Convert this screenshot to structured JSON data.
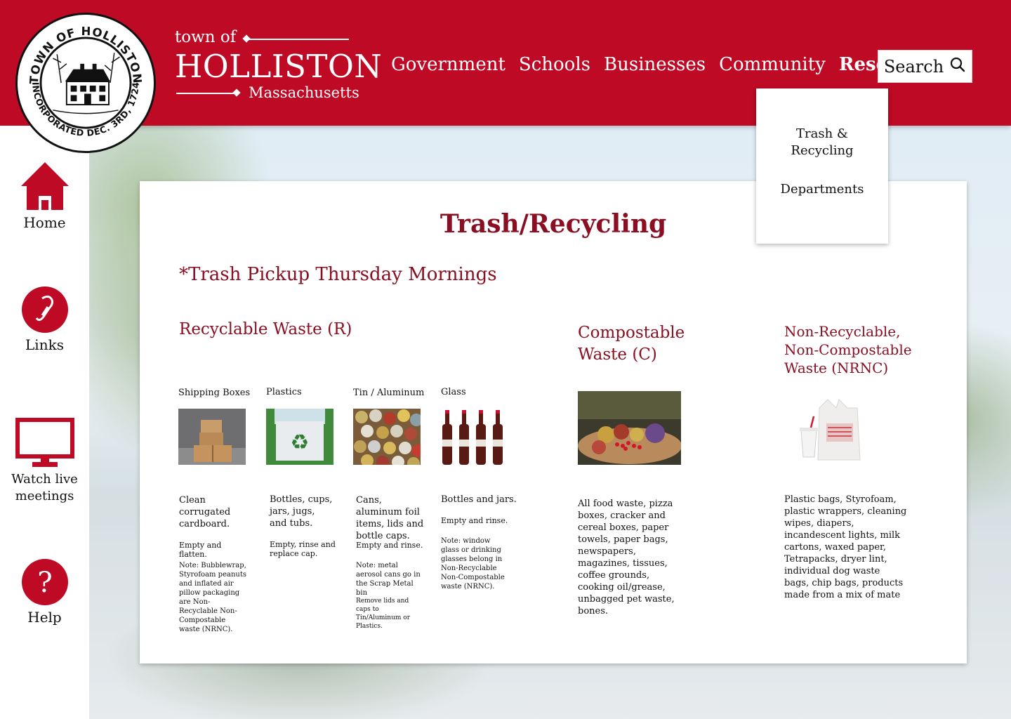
{
  "header": {
    "seal": {
      "top_text": "TOWN OF HOLLISTON",
      "bottom_text": "INCORPORATED DEC. 3RD, 1724"
    },
    "wordmark": {
      "town_of": "town of",
      "name": "HOLLISTON",
      "state": "Massachusetts"
    },
    "nav": [
      {
        "label": "Government"
      },
      {
        "label": "Schools"
      },
      {
        "label": "Businesses"
      },
      {
        "label": "Community"
      },
      {
        "label": "Resources",
        "active": true
      }
    ],
    "search": {
      "label": "Search",
      "icon": "search-icon"
    },
    "dropdown": {
      "items": [
        {
          "label": "Trash & Recycling"
        },
        {
          "label": "Departments"
        }
      ]
    }
  },
  "sidebar": {
    "items": [
      {
        "label": "Home",
        "icon": "home-icon"
      },
      {
        "label": "Links",
        "icon": "link-icon"
      },
      {
        "label": "Watch live meetings",
        "icon": "monitor-icon"
      },
      {
        "label": "Help",
        "icon": "help-icon"
      }
    ]
  },
  "page": {
    "title": "Trash/Recycling",
    "subtitle": "*Trash Pickup Thursday Mornings",
    "sections": {
      "recyclable": {
        "heading": "Recyclable Waste (R)",
        "categories": [
          {
            "label": "Shipping Boxes",
            "description": "Clean corrugated cardboard.",
            "instruction": "Empty and flatten.",
            "note": "Note: Bubblewrap, Styrofoam peanuts and inflated air pillow packaging are Non-Recyclable Non-Compostable waste (NRNC)."
          },
          {
            "label": "Plastics",
            "description": "Bottles, cups, jars, jugs, and tubs.",
            "instruction": "Empty, rinse and replace cap.",
            "note": ""
          },
          {
            "label": "Tin / Aluminum",
            "description": "Cans, aluminum foil items, lids and bottle caps.",
            "instruction": "Empty and rinse.",
            "note": "Note: metal aerosol cans go in the Scrap Metal bin",
            "note2": "Remove lids and caps to Tin/Aluminum or Plastics."
          },
          {
            "label": "Glass",
            "description": "Bottles and jars.",
            "instruction": "Empty and rinse.",
            "note": "Note: window glass or drinking glasses belong in Non-Recyclable Non-Compostable waste (NRNC)."
          }
        ]
      },
      "compostable": {
        "heading": "Compostable Waste (C)",
        "description": "All food waste, pizza boxes, cracker and cereal boxes, paper towels, paper bags, newspapers, magazines, tissues, coffee grounds, cooking oil/grease, unbagged pet waste, bones."
      },
      "nrnc": {
        "heading": "Non-Recyclable, Non-Compostable Waste (NRNC)",
        "description": "Plastic bags, Styrofoam, plastic wrappers, cleaning wipes, diapers, incandescent lights, milk cartons, waxed paper, Tetrapacks, dryer lint, individual dog waste bags, chip bags, products made from a mix of mate"
      }
    }
  },
  "colors": {
    "brand_red": "#bf0a26",
    "heading_red": "#8a0f22",
    "white": "#ffffff"
  }
}
